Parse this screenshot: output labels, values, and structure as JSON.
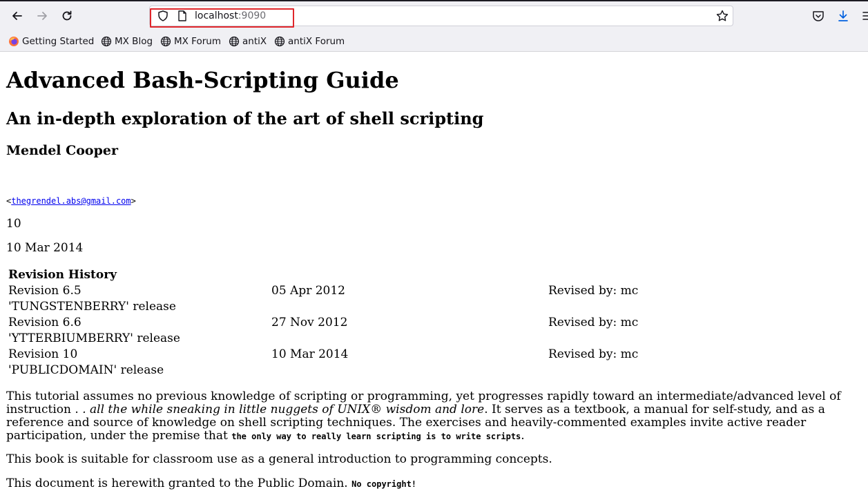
{
  "browser": {
    "url_host": "localhost",
    "url_port": ":9090",
    "bookmarks": [
      {
        "label": "Getting Started",
        "icon": "firefox-icon"
      },
      {
        "label": "MX Blog",
        "icon": "globe-icon"
      },
      {
        "label": "MX Forum",
        "icon": "globe-icon"
      },
      {
        "label": "antiX",
        "icon": "globe-icon"
      },
      {
        "label": "antiX Forum",
        "icon": "globe-icon"
      }
    ],
    "highlight_color": "#e0262b"
  },
  "page": {
    "title": "Advanced Bash-Scripting Guide",
    "subtitle": "An in-depth exploration of the art of shell scripting",
    "author": "Mendel Cooper",
    "email_open": "<",
    "email": "thegrendel.abs@gmail.com",
    "email_close": ">",
    "release": "10",
    "date": "10 Mar 2014",
    "revision_history": {
      "heading": "Revision History",
      "rows": [
        {
          "revision": "Revision 6.5",
          "date": "05 Apr 2012",
          "by": "Revised by: mc",
          "note": "'TUNGSTENBERRY' release"
        },
        {
          "revision": "Revision 6.6",
          "date": "27 Nov 2012",
          "by": "Revised by: mc",
          "note": "'YTTERBIUMBERRY' release"
        },
        {
          "revision": "Revision 10",
          "date": "10 Mar 2014",
          "by": "Revised by: mc",
          "note": "'PUBLICDOMAIN' release"
        }
      ]
    },
    "abstract": {
      "part1": "This tutorial assumes no previous knowledge of scripting or programming, yet progresses rapidly toward an intermediate/advanced level of instruction . ",
      "part2": ". all the while sneaking in little nuggets of UNIX® wisdom and lore",
      "part3": ". It serves as a textbook, a manual for self-study, and as a reference and source of knowledge on shell scripting techniques. The exercises and heavily-commented examples invite active reader participation, under the premise that ",
      "part4": "the only way to really learn scripting is to write scripts",
      "part5": "."
    },
    "classroom": "This book is suitable for classroom use as a general introduction to programming concepts.",
    "license_text": "This document is herewith granted to the Public Domain. ",
    "license_bold": "No copyright!"
  }
}
